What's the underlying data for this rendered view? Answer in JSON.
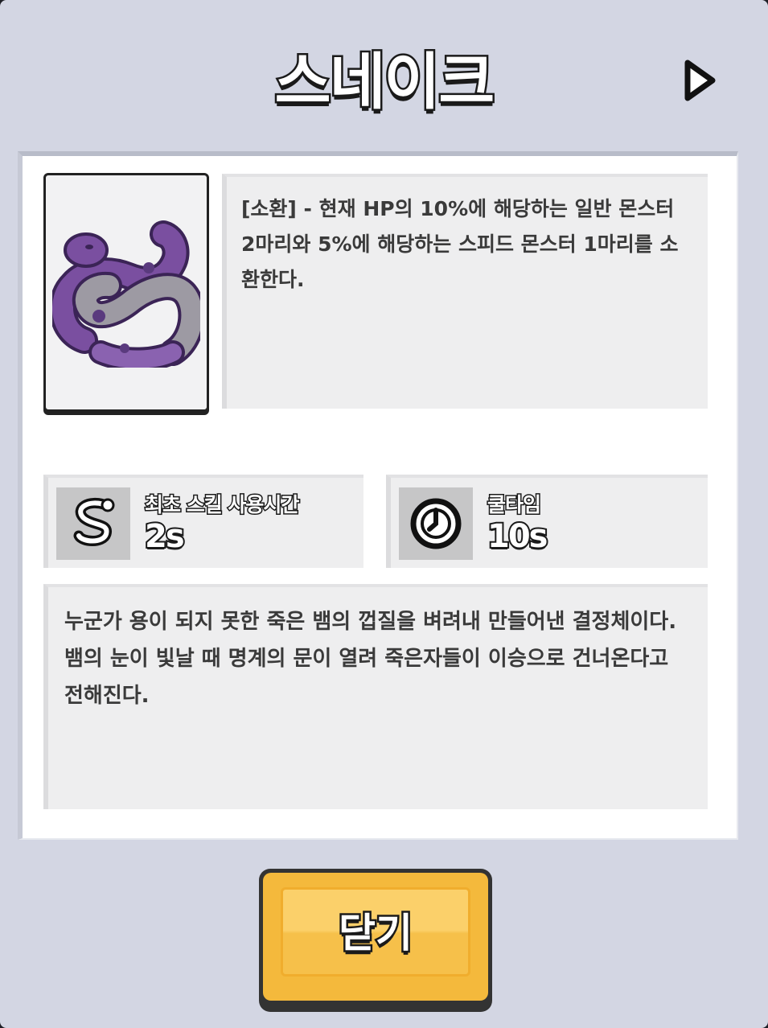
{
  "title": "스네이크",
  "next_icon": "play-arrow-icon",
  "skill": {
    "description": "[소환] - 현재 HP의 10%에 해당하는 일반 몬스터 2마리와 5%에 해당하는 스피드 몬스터 1마리를 소환한다.",
    "image_icon": "purple-snake-icon"
  },
  "stats": [
    {
      "icon": "snake-icon",
      "label": "최초 스킬 사용시간",
      "value": "2s"
    },
    {
      "icon": "cooldown-clock-icon",
      "label": "쿨타임",
      "value": "10s"
    }
  ],
  "lore": "누군가 용이 되지 못한 죽은 뱀의 껍질을 벼려내 만들어낸 결정체이다. 뱀의 눈이 빛날 때 명계의 문이 열려 죽은자들이 이승으로 건너온다고 전해진다.",
  "close_button": {
    "label": "닫기"
  },
  "colors": {
    "background": "#d3d6e3",
    "panel": "#ffffff",
    "text_box": "#eeeeef",
    "button": "#f4b93c",
    "snake_purple": "#7a4fa0"
  }
}
